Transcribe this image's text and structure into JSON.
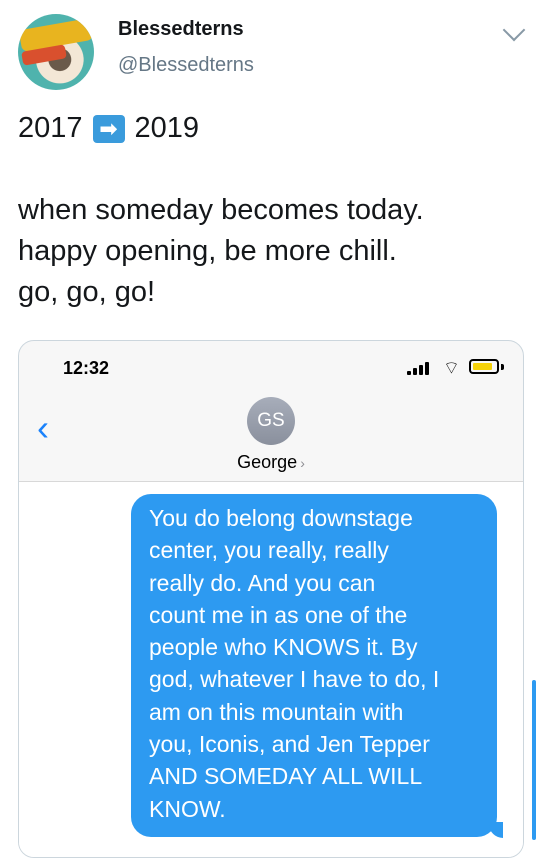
{
  "tweet": {
    "display_name": "Blessedterns",
    "handle": "@Blessedterns",
    "line1_start": "2017",
    "line1_end": "2019",
    "arrow_icon": "right-arrow-emoji",
    "body_lines": [
      "when someday becomes today.",
      "happy opening, be more chill.",
      "go, go, go!"
    ]
  },
  "phone": {
    "time": "12:32",
    "contact_initials": "GS",
    "contact_name": "George",
    "message_lines": [
      "You do belong downstage",
      "center, you really, really",
      "really do. And you can",
      "count me in as one of the",
      "people who KNOWS it. By",
      "god, whatever I have to do, I",
      "am on this mountain with",
      "you, Iconis, and Jen Tepper",
      "AND SOMEDAY ALL WILL",
      "KNOW."
    ],
    "bubble_color": "#2d9af1",
    "back_color": "#1a82fb",
    "battery_level": 0.85
  }
}
